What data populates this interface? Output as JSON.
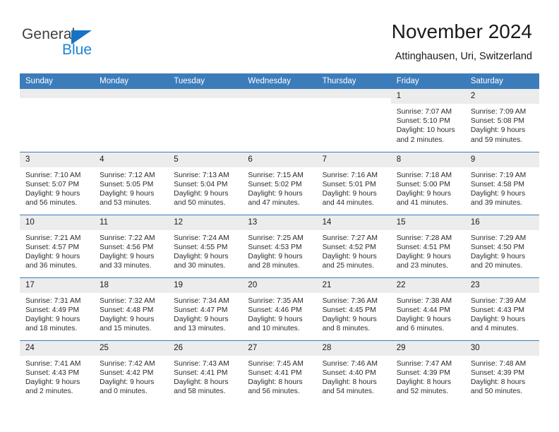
{
  "brand": {
    "name_top": "General",
    "name_bottom": "Blue",
    "color_dark": "#3f3f3f",
    "color_blue": "#1f83d4"
  },
  "header": {
    "title": "November 2024",
    "subtitle": "Attinghausen, Uri, Switzerland"
  },
  "theme": {
    "header_bg": "#3c7cba",
    "daynum_bg": "#ececec",
    "row_divider": "#3c7cba",
    "text": "#1a1a1a"
  },
  "weekdays": [
    "Sunday",
    "Monday",
    "Tuesday",
    "Wednesday",
    "Thursday",
    "Friday",
    "Saturday"
  ],
  "labels": {
    "sunrise": "Sunrise:",
    "sunset": "Sunset:",
    "daylight": "Daylight:"
  },
  "weeks": [
    [
      {
        "day": "",
        "empty": true
      },
      {
        "day": "",
        "empty": true
      },
      {
        "day": "",
        "empty": true
      },
      {
        "day": "",
        "empty": true
      },
      {
        "day": "",
        "empty": true
      },
      {
        "day": "1",
        "sunrise": "Sunrise: 7:07 AM",
        "sunset": "Sunset: 5:10 PM",
        "daylight": "Daylight: 10 hours and 2 minutes."
      },
      {
        "day": "2",
        "sunrise": "Sunrise: 7:09 AM",
        "sunset": "Sunset: 5:08 PM",
        "daylight": "Daylight: 9 hours and 59 minutes."
      }
    ],
    [
      {
        "day": "3",
        "sunrise": "Sunrise: 7:10 AM",
        "sunset": "Sunset: 5:07 PM",
        "daylight": "Daylight: 9 hours and 56 minutes."
      },
      {
        "day": "4",
        "sunrise": "Sunrise: 7:12 AM",
        "sunset": "Sunset: 5:05 PM",
        "daylight": "Daylight: 9 hours and 53 minutes."
      },
      {
        "day": "5",
        "sunrise": "Sunrise: 7:13 AM",
        "sunset": "Sunset: 5:04 PM",
        "daylight": "Daylight: 9 hours and 50 minutes."
      },
      {
        "day": "6",
        "sunrise": "Sunrise: 7:15 AM",
        "sunset": "Sunset: 5:02 PM",
        "daylight": "Daylight: 9 hours and 47 minutes."
      },
      {
        "day": "7",
        "sunrise": "Sunrise: 7:16 AM",
        "sunset": "Sunset: 5:01 PM",
        "daylight": "Daylight: 9 hours and 44 minutes."
      },
      {
        "day": "8",
        "sunrise": "Sunrise: 7:18 AM",
        "sunset": "Sunset: 5:00 PM",
        "daylight": "Daylight: 9 hours and 41 minutes."
      },
      {
        "day": "9",
        "sunrise": "Sunrise: 7:19 AM",
        "sunset": "Sunset: 4:58 PM",
        "daylight": "Daylight: 9 hours and 39 minutes."
      }
    ],
    [
      {
        "day": "10",
        "sunrise": "Sunrise: 7:21 AM",
        "sunset": "Sunset: 4:57 PM",
        "daylight": "Daylight: 9 hours and 36 minutes."
      },
      {
        "day": "11",
        "sunrise": "Sunrise: 7:22 AM",
        "sunset": "Sunset: 4:56 PM",
        "daylight": "Daylight: 9 hours and 33 minutes."
      },
      {
        "day": "12",
        "sunrise": "Sunrise: 7:24 AM",
        "sunset": "Sunset: 4:55 PM",
        "daylight": "Daylight: 9 hours and 30 minutes."
      },
      {
        "day": "13",
        "sunrise": "Sunrise: 7:25 AM",
        "sunset": "Sunset: 4:53 PM",
        "daylight": "Daylight: 9 hours and 28 minutes."
      },
      {
        "day": "14",
        "sunrise": "Sunrise: 7:27 AM",
        "sunset": "Sunset: 4:52 PM",
        "daylight": "Daylight: 9 hours and 25 minutes."
      },
      {
        "day": "15",
        "sunrise": "Sunrise: 7:28 AM",
        "sunset": "Sunset: 4:51 PM",
        "daylight": "Daylight: 9 hours and 23 minutes."
      },
      {
        "day": "16",
        "sunrise": "Sunrise: 7:29 AM",
        "sunset": "Sunset: 4:50 PM",
        "daylight": "Daylight: 9 hours and 20 minutes."
      }
    ],
    [
      {
        "day": "17",
        "sunrise": "Sunrise: 7:31 AM",
        "sunset": "Sunset: 4:49 PM",
        "daylight": "Daylight: 9 hours and 18 minutes."
      },
      {
        "day": "18",
        "sunrise": "Sunrise: 7:32 AM",
        "sunset": "Sunset: 4:48 PM",
        "daylight": "Daylight: 9 hours and 15 minutes."
      },
      {
        "day": "19",
        "sunrise": "Sunrise: 7:34 AM",
        "sunset": "Sunset: 4:47 PM",
        "daylight": "Daylight: 9 hours and 13 minutes."
      },
      {
        "day": "20",
        "sunrise": "Sunrise: 7:35 AM",
        "sunset": "Sunset: 4:46 PM",
        "daylight": "Daylight: 9 hours and 10 minutes."
      },
      {
        "day": "21",
        "sunrise": "Sunrise: 7:36 AM",
        "sunset": "Sunset: 4:45 PM",
        "daylight": "Daylight: 9 hours and 8 minutes."
      },
      {
        "day": "22",
        "sunrise": "Sunrise: 7:38 AM",
        "sunset": "Sunset: 4:44 PM",
        "daylight": "Daylight: 9 hours and 6 minutes."
      },
      {
        "day": "23",
        "sunrise": "Sunrise: 7:39 AM",
        "sunset": "Sunset: 4:43 PM",
        "daylight": "Daylight: 9 hours and 4 minutes."
      }
    ],
    [
      {
        "day": "24",
        "sunrise": "Sunrise: 7:41 AM",
        "sunset": "Sunset: 4:43 PM",
        "daylight": "Daylight: 9 hours and 2 minutes."
      },
      {
        "day": "25",
        "sunrise": "Sunrise: 7:42 AM",
        "sunset": "Sunset: 4:42 PM",
        "daylight": "Daylight: 9 hours and 0 minutes."
      },
      {
        "day": "26",
        "sunrise": "Sunrise: 7:43 AM",
        "sunset": "Sunset: 4:41 PM",
        "daylight": "Daylight: 8 hours and 58 minutes."
      },
      {
        "day": "27",
        "sunrise": "Sunrise: 7:45 AM",
        "sunset": "Sunset: 4:41 PM",
        "daylight": "Daylight: 8 hours and 56 minutes."
      },
      {
        "day": "28",
        "sunrise": "Sunrise: 7:46 AM",
        "sunset": "Sunset: 4:40 PM",
        "daylight": "Daylight: 8 hours and 54 minutes."
      },
      {
        "day": "29",
        "sunrise": "Sunrise: 7:47 AM",
        "sunset": "Sunset: 4:39 PM",
        "daylight": "Daylight: 8 hours and 52 minutes."
      },
      {
        "day": "30",
        "sunrise": "Sunrise: 7:48 AM",
        "sunset": "Sunset: 4:39 PM",
        "daylight": "Daylight: 8 hours and 50 minutes."
      }
    ]
  ]
}
